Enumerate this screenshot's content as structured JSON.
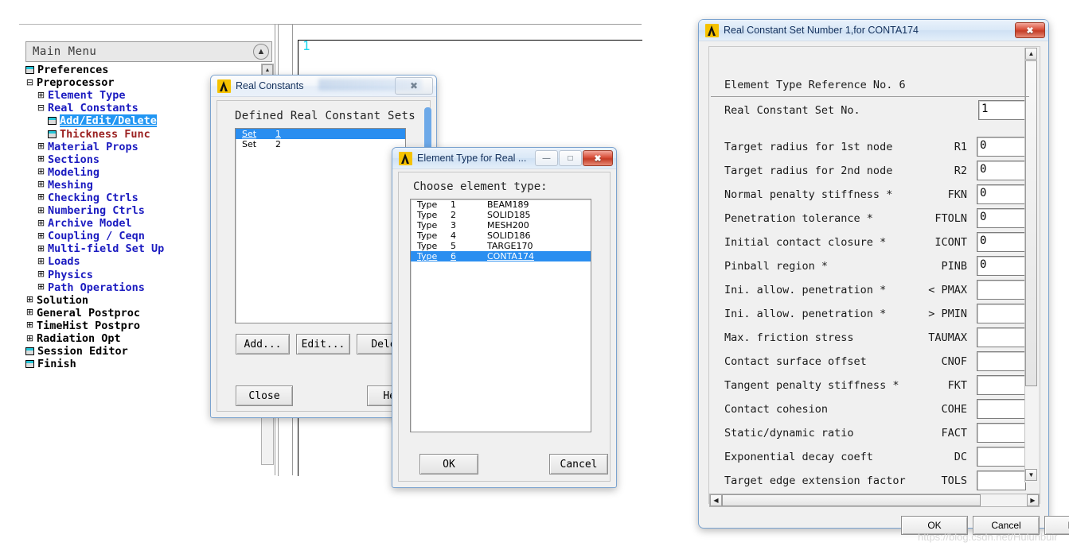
{
  "background": {
    "menu_header": {
      "title": "Main Menu",
      "collapse_icon": "chevron-up-icon"
    },
    "graphics_label": "1",
    "tree": [
      {
        "level": 0,
        "toggle": "",
        "icon": "sheet-icon",
        "label": "Preferences",
        "color": "black",
        "selected": false
      },
      {
        "level": 0,
        "toggle": "⊟",
        "icon": "",
        "label": "Preprocessor",
        "color": "black",
        "selected": false
      },
      {
        "level": 1,
        "toggle": "⊞",
        "icon": "",
        "label": "Element Type",
        "color": "blue",
        "selected": false
      },
      {
        "level": 1,
        "toggle": "⊟",
        "icon": "",
        "label": "Real Constants",
        "color": "blue",
        "selected": false
      },
      {
        "level": 2,
        "toggle": "",
        "icon": "sheet-icon",
        "label": "Add/Edit/Delete",
        "color": "blue",
        "selected": true
      },
      {
        "level": 2,
        "toggle": "",
        "icon": "sheet-icon",
        "label": "Thickness Func",
        "color": "red",
        "selected": false
      },
      {
        "level": 1,
        "toggle": "⊞",
        "icon": "",
        "label": "Material Props",
        "color": "blue",
        "selected": false
      },
      {
        "level": 1,
        "toggle": "⊞",
        "icon": "",
        "label": "Sections",
        "color": "blue",
        "selected": false
      },
      {
        "level": 1,
        "toggle": "⊞",
        "icon": "",
        "label": "Modeling",
        "color": "blue",
        "selected": false
      },
      {
        "level": 1,
        "toggle": "⊞",
        "icon": "",
        "label": "Meshing",
        "color": "blue",
        "selected": false
      },
      {
        "level": 1,
        "toggle": "⊞",
        "icon": "",
        "label": "Checking Ctrls",
        "color": "blue",
        "selected": false
      },
      {
        "level": 1,
        "toggle": "⊞",
        "icon": "",
        "label": "Numbering Ctrls",
        "color": "blue",
        "selected": false
      },
      {
        "level": 1,
        "toggle": "⊞",
        "icon": "",
        "label": "Archive Model",
        "color": "blue",
        "selected": false
      },
      {
        "level": 1,
        "toggle": "⊞",
        "icon": "",
        "label": "Coupling / Ceqn",
        "color": "blue",
        "selected": false
      },
      {
        "level": 1,
        "toggle": "⊞",
        "icon": "",
        "label": "Multi-field Set Up",
        "color": "blue",
        "selected": false
      },
      {
        "level": 1,
        "toggle": "⊞",
        "icon": "",
        "label": "Loads",
        "color": "blue",
        "selected": false
      },
      {
        "level": 1,
        "toggle": "⊞",
        "icon": "",
        "label": "Physics",
        "color": "blue",
        "selected": false
      },
      {
        "level": 1,
        "toggle": "⊞",
        "icon": "",
        "label": "Path Operations",
        "color": "blue",
        "selected": false
      },
      {
        "level": 0,
        "toggle": "⊞",
        "icon": "",
        "label": "Solution",
        "color": "black",
        "selected": false
      },
      {
        "level": 0,
        "toggle": "⊞",
        "icon": "",
        "label": "General Postproc",
        "color": "black",
        "selected": false
      },
      {
        "level": 0,
        "toggle": "⊞",
        "icon": "",
        "label": "TimeHist Postpro",
        "color": "black",
        "selected": false
      },
      {
        "level": 0,
        "toggle": "⊞",
        "icon": "",
        "label": "Radiation Opt",
        "color": "black",
        "selected": false
      },
      {
        "level": 0,
        "toggle": "",
        "icon": "sheet-icon",
        "label": "Session Editor",
        "color": "black",
        "selected": false
      },
      {
        "level": 0,
        "toggle": "",
        "icon": "sheet-icon",
        "label": "Finish",
        "color": "black",
        "selected": false
      }
    ]
  },
  "real_constants_dialog": {
    "title": "Real Constants",
    "close_label": "✖",
    "heading": "Defined Real Constant Sets",
    "sets": [
      {
        "label": "Set",
        "number": "1",
        "selected": true
      },
      {
        "label": "Set",
        "number": "2",
        "selected": false
      }
    ],
    "buttons": {
      "add": "Add...",
      "edit": "Edit...",
      "delete": "Dele",
      "close": "Close",
      "help": "Help"
    }
  },
  "element_type_dialog": {
    "title": "Element Type for Real ...",
    "minimize_label": "—",
    "restore_label": "□",
    "close_label": "✖",
    "heading": "Choose element type:",
    "types": [
      {
        "label": "Type",
        "number": "1",
        "name": "BEAM189",
        "selected": false
      },
      {
        "label": "Type",
        "number": "2",
        "name": "SOLID185",
        "selected": false
      },
      {
        "label": "Type",
        "number": "3",
        "name": "MESH200",
        "selected": false
      },
      {
        "label": "Type",
        "number": "4",
        "name": "SOLID186",
        "selected": false
      },
      {
        "label": "Type",
        "number": "5",
        "name": "TARGE170",
        "selected": false
      },
      {
        "label": "Type",
        "number": "6",
        "name": "CONTA174",
        "selected": true
      }
    ],
    "buttons": {
      "ok": "OK",
      "cancel": "Cancel"
    }
  },
  "real_constant_set_dialog": {
    "title": "Real Constant Set Number 1,for CONTA174",
    "close_label": "✖",
    "header_rows": [
      {
        "label": "Element Type Reference No. 6",
        "code": "",
        "value": null
      },
      {
        "label": "Real Constant Set No.",
        "code": "",
        "value": "1"
      }
    ],
    "rows": [
      {
        "label": "Target radius for 1st node",
        "code": "R1",
        "value": "0"
      },
      {
        "label": "Target radius for 2nd node",
        "code": "R2",
        "value": "0"
      },
      {
        "label": "Normal penalty stiffness *",
        "code": "FKN",
        "value": "0"
      },
      {
        "label": "Penetration tolerance *",
        "code": "FTOLN",
        "value": "0"
      },
      {
        "label": "Initial contact closure *",
        "code": "ICONT",
        "value": "0"
      },
      {
        "label": "Pinball region *",
        "code": "PINB",
        "value": "0"
      },
      {
        "label": "Ini. allow. penetration *",
        "code": "< PMAX",
        "value": ""
      },
      {
        "label": "Ini. allow. penetration *",
        "code": "> PMIN",
        "value": ""
      },
      {
        "label": "Max. friction stress",
        "code": "TAUMAX",
        "value": ""
      },
      {
        "label": "Contact surface offset",
        "code": "CNOF",
        "value": ""
      },
      {
        "label": "Tangent penalty stiffness *",
        "code": "FKT",
        "value": ""
      },
      {
        "label": "Contact cohesion",
        "code": "COHE",
        "value": ""
      },
      {
        "label": "Static/dynamic ratio",
        "code": "FACT",
        "value": ""
      },
      {
        "label": "Exponential decay coeft",
        "code": "DC",
        "value": ""
      },
      {
        "label": "Target edge extension factor",
        "code": "TOLS",
        "value": ""
      }
    ],
    "buttons": {
      "ok": "OK",
      "cancel": "Cancel",
      "help": "Help"
    },
    "scroll": {
      "up_icon": "triangle-up-icon",
      "down_icon": "triangle-down-icon",
      "left_icon": "triangle-left-icon",
      "right_icon": "triangle-right-icon"
    }
  },
  "watermark": "https://blog.csdn.net/Hulunbuir",
  "colors": {
    "selection_blue": "#2a8ef0",
    "tree_blue": "#1b1bc0",
    "tree_red": "#9b2222",
    "close_red": "#c43c26",
    "graphics_cyan": "#1ad8f0"
  }
}
